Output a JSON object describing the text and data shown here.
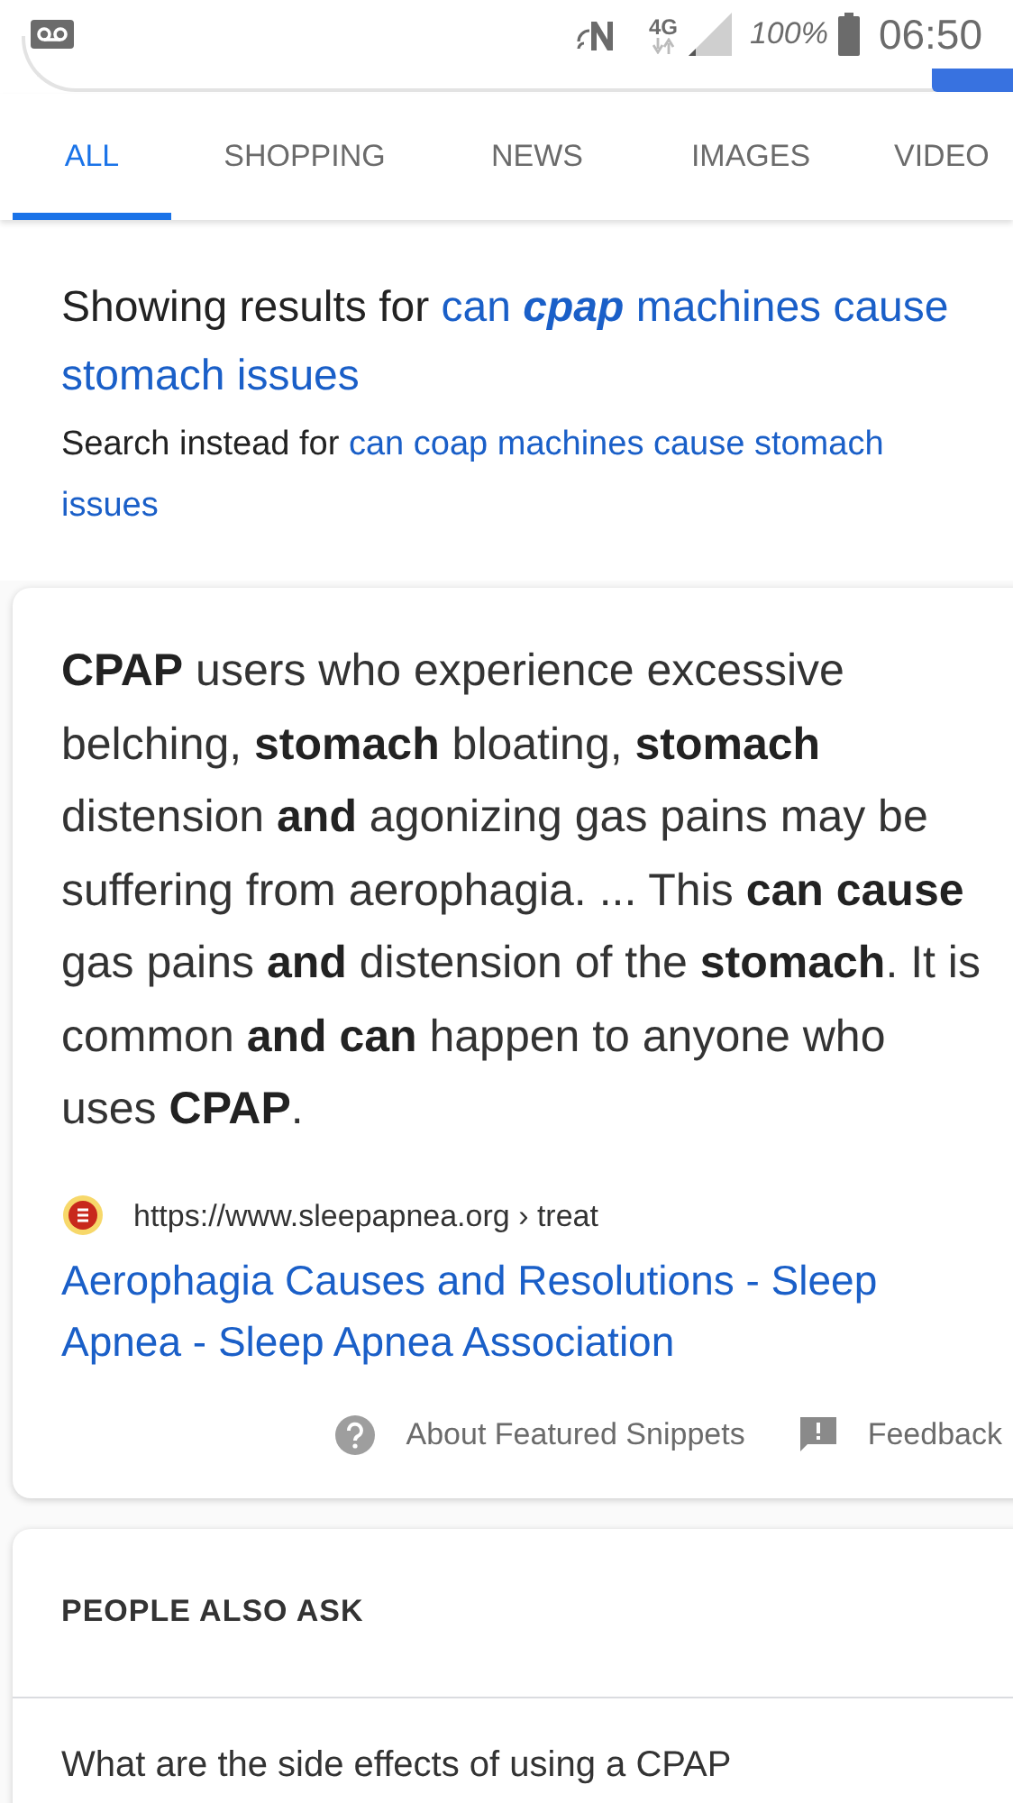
{
  "status_bar": {
    "network": "4G",
    "battery": "100%",
    "time": "06:50"
  },
  "tabs": [
    {
      "label": "ALL",
      "selected": true
    },
    {
      "label": "SHOPPING",
      "selected": false
    },
    {
      "label": "NEWS",
      "selected": false
    },
    {
      "label": "IMAGES",
      "selected": false
    },
    {
      "label": "VIDEO",
      "selected": false
    }
  ],
  "spelling": {
    "showing_prefix": "Showing results for",
    "corrected_query": "can **cpap** machines cause stomach issues",
    "instead_prefix": "Search instead for",
    "original_query": "can coap machines cause stomach issues"
  },
  "featured_snippet": {
    "text": "**CPAP** users who experience excessive belching, **stomach** bloating, **stomach** distension **and** agonizing gas pains may be suffering from aerophagia. ... This **can cause** gas pains **and** distension of the **stomach**. It is common **and can** happen to anyone who uses **CPAP**.",
    "source_url": "https://www.sleepapnea.org › treat",
    "title": "Aerophagia Causes and Resolutions - Sleep Apnea - Sleep Apnea Association",
    "footer_links": [
      {
        "kind": "help",
        "label": "About Featured Snippets"
      },
      {
        "kind": "feedback",
        "label": "Feedback"
      }
    ]
  },
  "people_also_ask": {
    "heading": "PEOPLE ALSO ASK",
    "questions": [
      "What are the side effects of using a CPAP"
    ]
  }
}
